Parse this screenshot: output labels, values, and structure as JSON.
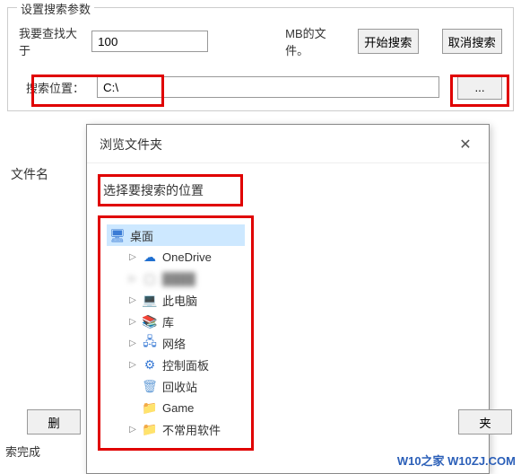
{
  "group": {
    "title": "设置搜索参数"
  },
  "row1": {
    "label_prefix": "我要查找大于",
    "size_value": "100",
    "label_suffix": "MB的文件。",
    "btn_start": "开始搜索",
    "btn_cancel": "取消搜索"
  },
  "row2": {
    "label": "搜索位置：",
    "path": "C:\\",
    "browse": "..."
  },
  "sidebar": {
    "filename_header": "文件名"
  },
  "dialog": {
    "title": "浏览文件夹",
    "close": "✕",
    "message": "选择要搜索的位置"
  },
  "tree": {
    "root": "桌面",
    "items": [
      {
        "icon": "☁",
        "label": "OneDrive",
        "icon_color": "#1f6fd0"
      },
      {
        "icon": "",
        "label": "",
        "blur": true
      },
      {
        "icon": "💻",
        "label": "此电脑",
        "icon_color": "#3a7bd5"
      },
      {
        "icon": "📚",
        "label": "库",
        "icon_color": "#e0b84a"
      },
      {
        "icon": "🖧",
        "label": "网络",
        "icon_color": "#3a7bd5"
      },
      {
        "icon": "⚙",
        "label": "控制面板",
        "icon_color": "#3a7bd5"
      },
      {
        "icon": "🗑",
        "label": "回收站",
        "icon_color": "#6aa0d8"
      },
      {
        "icon": "📁",
        "label": "Game",
        "icon_color": "#e0b84a"
      },
      {
        "icon": "📁",
        "label": "不常用软件",
        "icon_color": "#e0b84a"
      }
    ]
  },
  "buttons": {
    "delete": "删",
    "folder": "夹"
  },
  "status": "索完成",
  "watermark": "W10之家 W10ZJ.COM"
}
